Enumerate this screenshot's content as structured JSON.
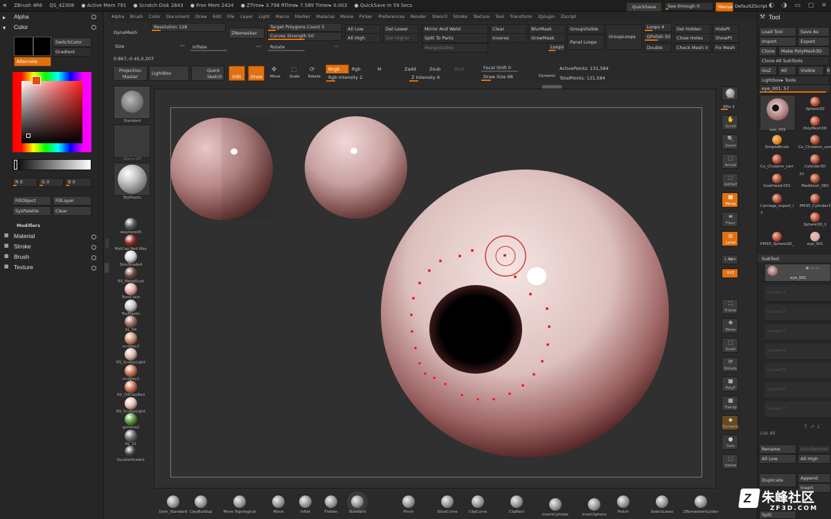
{
  "titlebar": {
    "app": "ZBrush 4R6",
    "items": [
      "QS_42308",
      "● Active Mem 791",
      "● Scratch Disk 2843",
      "● Free Mem 2424",
      "● ZTime▸ 3.798 RTime▸ 7.589 Timer▸ 0.003",
      "● QuickSave In 59 Secs"
    ],
    "quicksave": "QuickSave",
    "seethrough": "See-through  0",
    "menus": "Menus",
    "defaultzscript": "DefaultZScript"
  },
  "menubar": [
    "Alpha",
    "Brush",
    "Color",
    "Document",
    "Draw",
    "Edit",
    "File",
    "Layer",
    "Light",
    "Macro",
    "Marker",
    "Material",
    "Movie",
    "Picker",
    "Preferences",
    "Render",
    "Stencil",
    "Stroke",
    "Texture",
    "Tool",
    "Transform",
    "Zplugin",
    "Zscript"
  ],
  "left": {
    "alpha": "Alpha",
    "color": "Color",
    "switchcolor": "SwitchColor",
    "gradient": "Gradient",
    "alternate": "Alternate",
    "r": "R 0",
    "g": "G 0",
    "b": "B 0",
    "fillobject": "FillObject",
    "filllayer": "FillLayer",
    "syspalette": "SysPalette",
    "clear": "Clear",
    "modifiers": "Modifiers",
    "material": "Material",
    "stroke": "Stroke",
    "brush": "Brush",
    "texture": "Texture"
  },
  "shelf": {
    "dynamesh": "DynaMesh",
    "resolution": "Resolution 128",
    "zremesher": "ZRemesher",
    "target_poly": "Target Polygons Count 5",
    "curves_strength": "Curves Strength 50",
    "all_low": "All Low",
    "all_high": "All High",
    "del_lower": "Del Lower",
    "del_higher": "Del Higher",
    "mirror_weld": "Mirror And Weld",
    "split_parts": "Split To Parts",
    "merge_visible": "MergeVisible",
    "clear": "Clear",
    "inverse": "Inverse",
    "blurmask": "BlurMask",
    "growmask": "GrowMask",
    "loops_s": "Loops",
    "groupvisible": "GroupVisible",
    "panel_loops": "Panel Loops",
    "grouploops": "GroupLoops",
    "loops4": "Loops 4",
    "gpolish": "GPolish 50",
    "double": "Double",
    "del_hidden": "Del Hidden",
    "close_holes": "Close Holes",
    "check_mesh": "Check Mesh Ir",
    "hidept": "HidePt",
    "showpt": "ShowPt",
    "fix_mesh": "Fix Mesh",
    "size": "Size",
    "inflate": "Inflate",
    "rotate": "Rotate",
    "coords": "0.867,-0.45,0.207",
    "projection_master": "Projection Master",
    "lightbox": "LightBox",
    "quick_sketch": "Quick Sketch",
    "edit": "Edit",
    "draw": "Draw",
    "move": "Move",
    "scale": "Scale",
    "rotate_b": "Rotate",
    "mrgb": "Mrgb",
    "rgb": "Rgb",
    "m": "M",
    "zadd": "Zadd",
    "zsub": "Zsub",
    "zcut": "Zcut",
    "rgb_intensity": "Rgb Intensity 2",
    "z_intensity": "Z Intensity 6",
    "focal_shift": "Focal Shift 0",
    "draw_size": "Draw Size 68",
    "dynamic": "Dynamic",
    "active_points": "ActivePoints: 131,584",
    "total_points": "TotalPoints: 131,584"
  },
  "lefttray": {
    "standard": "Standard",
    "alpha_off": "Alpha Off",
    "toyplastic": "ToyPlastic",
    "materials": [
      {
        "name": "waynered5",
        "color": "#5a5a5a"
      },
      {
        "name": "MatCap Red Wax",
        "color": "#8a2a20"
      },
      {
        "name": "SkinShade4",
        "color": "#d8d8d8"
      },
      {
        "name": "RS_MetalDust",
        "color": "#6a4a3a"
      },
      {
        "name": "Toms skin",
        "color": "#e8a8a0"
      },
      {
        "name": "ToyPlastic",
        "color": "#c8c8c8"
      },
      {
        "name": "AL_04",
        "color": "#9a6a5a"
      },
      {
        "name": "sculpey2",
        "color": "#d09070"
      },
      {
        "name": "RS_SculpyLight",
        "color": "#dab8a8"
      },
      {
        "name": "sculpey2",
        "color": "#c87858"
      },
      {
        "name": "RS_OilClayRed",
        "color": "#d07050"
      },
      {
        "name": "RS_SculpyLight",
        "color": "#e8c0b0"
      },
      {
        "name": "gomma2",
        "color": "#5a9a3a"
      },
      {
        "name": "AL_11",
        "color": "#6a6a6a"
      },
      {
        "name": "DoubleShade1",
        "color": "#3a3a3a"
      }
    ]
  },
  "righttray": {
    "bpr": "BPR",
    "spix": "SPix 3",
    "items": [
      "Scroll",
      "Zoom",
      "Actual",
      "AAHalf",
      "Persp",
      "Floor",
      "Local",
      "L.Sym",
      "XYZ",
      "Frame",
      "Move",
      "Scale",
      "Rotate",
      "PolyF",
      "Transp",
      "Dynamic",
      "Solo",
      "Xpose"
    ]
  },
  "toolpanel": {
    "title": "Tool",
    "load_tool": "Load Tool",
    "save_as": "Save As",
    "import": "Import",
    "export": "Export",
    "clone": "Clone",
    "make_polymesh": "Make PolyMesh3D",
    "clone_all": "Clone All SubTools",
    "goz": "GoZ",
    "all": "All",
    "visible": "Visible",
    "r": "R",
    "lightbox_tools": "Lightbox▸ Tools",
    "current_tool": "eye_001. 57",
    "thumbs": [
      {
        "name": "eye_001"
      },
      {
        "name": "Sphere3D"
      },
      {
        "name": "PolyMesh3D"
      },
      {
        "name": "SimpleBrush"
      },
      {
        "name": "Cu_Chulainn_carr"
      },
      {
        "name": "Cu_Chulainn_carrie"
      },
      {
        "name": "Cylinder3D"
      },
      {
        "name": "Goathead-001"
      },
      {
        "name": "Maddison_062"
      },
      {
        "name": "Carriage_export_C"
      },
      {
        "name": "PM3D_Cylinder3"
      },
      {
        "name": "Sphere3D_1"
      },
      {
        "name": "PM3D_Sphere3D_1"
      },
      {
        "name": "eye_001"
      }
    ],
    "count30": "30",
    "count3": "3",
    "subtool": "SubTool",
    "subtool_item": "eye_001",
    "unused": [
      "Unused 1",
      "Unused 2",
      "Unused 3",
      "Unused 4",
      "Unused 5",
      "Unused 6",
      "Unused 7"
    ],
    "list_all": "List All",
    "rename": "Rename",
    "autoreorder": "AutoReorder",
    "all_low": "All Low",
    "all_high": "All High",
    "duplicate": "Duplicate",
    "append": "Append",
    "insert": "Insert",
    "split": "Split"
  },
  "bottom": {
    "brushes": [
      "Dam_Standard",
      "ClayBuildup",
      "Move Topological",
      "Move",
      "Inflat",
      "Flatten",
      "Standard",
      "Pinch",
      "SliceCurve",
      "ClipCurve",
      "ClipRect",
      "InsertCylinder",
      "InsertSphere",
      "Polish",
      "SelectLasso",
      "ZRemesherGuides"
    ]
  },
  "watermark": {
    "big": "朱峰社区",
    "small": "ZF3D.COM"
  }
}
